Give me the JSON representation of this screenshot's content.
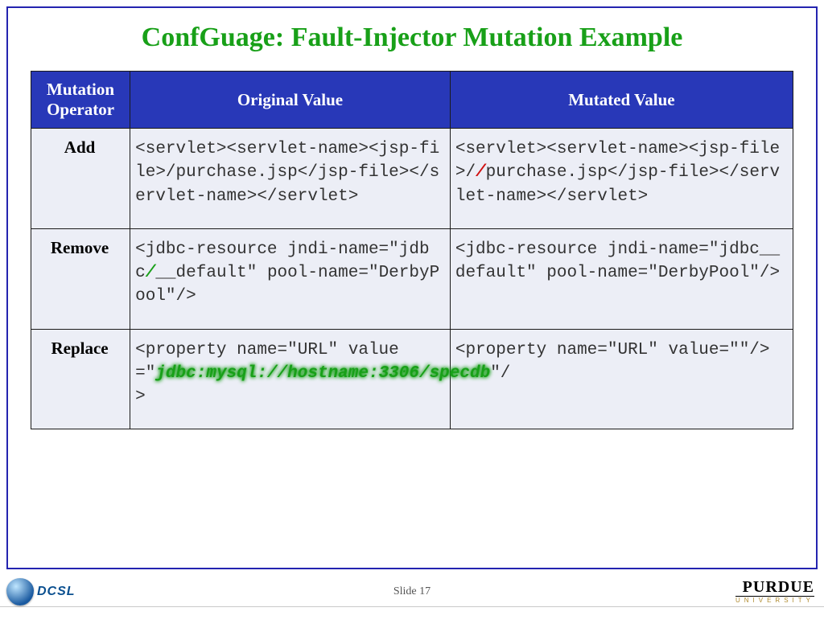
{
  "title": "ConfGuage: Fault-Injector Mutation Example",
  "slide_label": "Slide 17",
  "left_logo_text": "DCSL",
  "right_logo_top": "PURDUE",
  "right_logo_bottom": "UNIVERSITY",
  "headers": {
    "op": "Mutation Operator",
    "orig": "Original Value",
    "mut": "Mutated Value"
  },
  "rows": {
    "add": {
      "op": "Add",
      "orig": "<servlet><servlet-name><jsp-file>/purchase.jsp</jsp-file></servlet-name></servlet>",
      "mut_pre": "<servlet><servlet-name><jsp-file>/",
      "mut_hl": "/",
      "mut_post": "purchase.jsp</jsp-file></servlet-name></servlet>"
    },
    "remove": {
      "op": "Remove",
      "orig_pre": "<jdbc-resource jndi-name=\"jdbc",
      "orig_hl": "/",
      "orig_post": "__default\" pool-name=\"DerbyPool\"/>",
      "mut": "<jdbc-resource jndi-name=\"jdbc__default\" pool-name=\"DerbyPool\"/>"
    },
    "replace": {
      "op": "Replace",
      "orig_pre": "<property name=\"URL\" value=\"",
      "orig_hl": "jdbc:mysql://hostname:3306/specdb",
      "orig_post": "\"/>",
      "mut": "<property name=\"URL\" value=\"\"/>"
    }
  }
}
